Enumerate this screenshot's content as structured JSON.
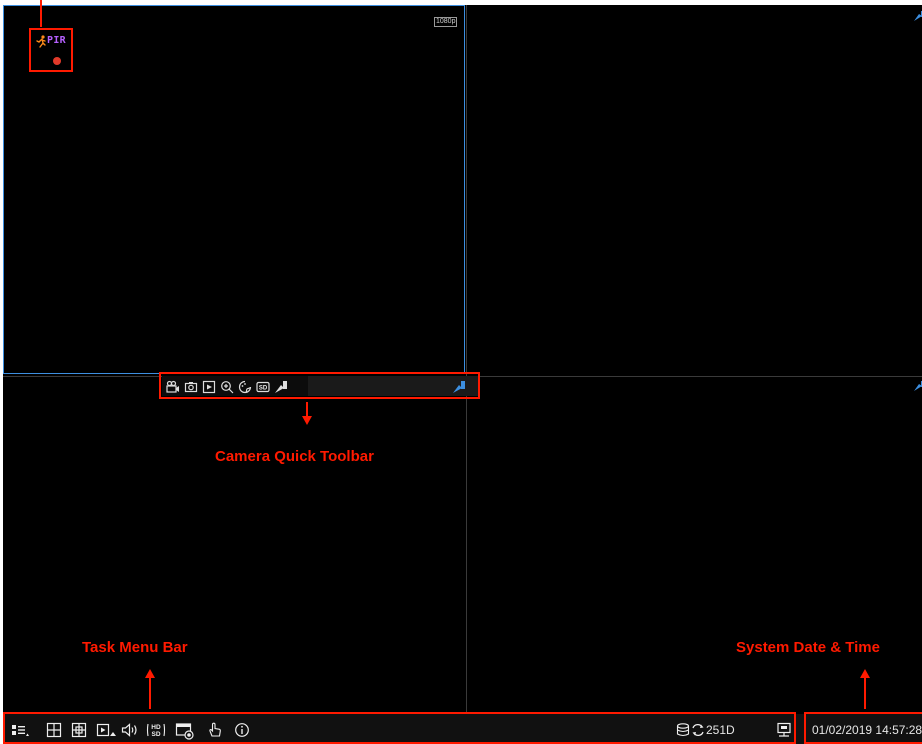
{
  "camera_view": {
    "resolution_badge": "1080p",
    "status": {
      "motion_icon": "running-person-icon",
      "pir_label": "PIR",
      "recording_icon": "record-dot-icon"
    }
  },
  "quick_toolbar": {
    "icons": [
      "record-video-icon",
      "snapshot-icon",
      "playback-icon",
      "zoom-icon",
      "color-adjust-icon",
      "sd-stream-icon",
      "ptz-icon"
    ],
    "sd_label": "SD"
  },
  "task_menu": {
    "icons": [
      "main-menu-icon",
      "layout-quad-icon",
      "layout-multi-icon",
      "sequence-icon",
      "audio-icon",
      "hd-sd-icon",
      "record-icon",
      "manual-alarm-icon",
      "info-icon"
    ],
    "hd_label": "HD",
    "sd_label": "SD"
  },
  "storage": {
    "label": "251D",
    "icons": [
      "storage-disk-icon",
      "overwrite-cycle-icon"
    ]
  },
  "network_icon": "network-icon",
  "system_datetime": "01/02/2019 14:57:28",
  "annotations": {
    "quick_toolbar_label": "Camera Quick Toolbar",
    "task_menu_label": "Task Menu Bar",
    "datetime_label": "System Date & Time"
  },
  "colors": {
    "annotation": "#ff1a00",
    "selection": "#3d8fe0",
    "pir": "#b560ff",
    "motion": "#ff8a1a",
    "ptz": "#3d8fe0"
  }
}
